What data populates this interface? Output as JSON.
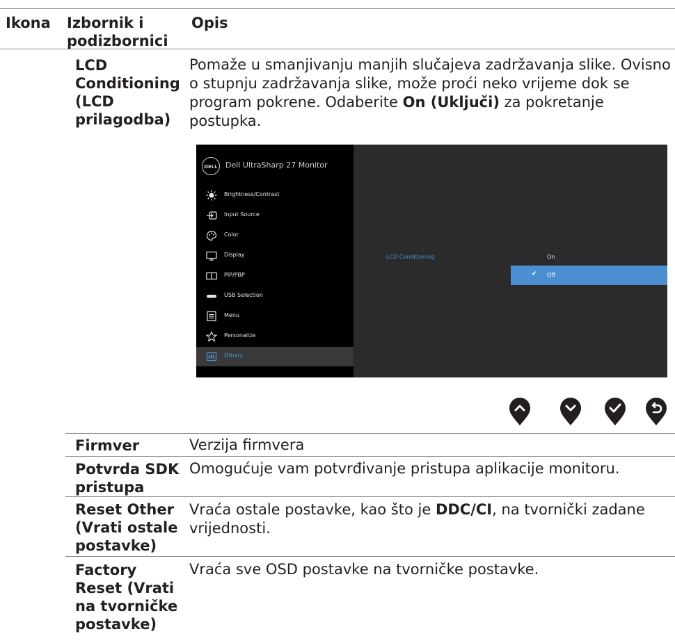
{
  "header": {
    "col_icon": "Ikona",
    "col_menu": "Izbornik i podizbornici",
    "col_desc": "Opis"
  },
  "lcd": {
    "menu": "LCD Conditioning (LCD prilagodba)",
    "desc_pre": "Pomaže u smanjivanju manjih slučajeva zadržavanja slike. Ovisno o stupnju zadržavanja slike, može proći neko vrijeme dok se program pokrene. Odaberite ",
    "desc_bold": "On (Uključi)",
    "desc_post": " za pokretanje postupka."
  },
  "osd": {
    "logo": "DELL",
    "title": "Dell UltraSharp 27 Monitor",
    "items": [
      {
        "label": "Brightness/Contrast",
        "icon": "brightness-icon"
      },
      {
        "label": "Input Source",
        "icon": "input-source-icon"
      },
      {
        "label": "Color",
        "icon": "color-palette-icon"
      },
      {
        "label": "Display",
        "icon": "display-icon"
      },
      {
        "label": "PIP/PBP",
        "icon": "pip-pbp-icon"
      },
      {
        "label": "USB Selection",
        "icon": "usb-icon"
      },
      {
        "label": "Menu",
        "icon": "menu-icon"
      },
      {
        "label": "Personalize",
        "icon": "star-icon"
      },
      {
        "label": "Others",
        "icon": "others-icon"
      }
    ],
    "option_label": "LCD Conditioning",
    "option_on": "On",
    "option_off": "Off",
    "selected": "Off",
    "accent": "#4b8fd2"
  },
  "nav_icons": [
    "up-arrow-icon",
    "down-arrow-icon",
    "check-icon",
    "back-icon"
  ],
  "rows": [
    {
      "menu": "Firmver",
      "desc": "Verzija firmvera"
    },
    {
      "menu": "Potvrda SDK pristupa",
      "desc": "Omogućuje vam potvrđivanje pristupa aplikacije monitoru."
    },
    {
      "menu": "Reset Other (Vrati ostale postavke)",
      "desc_pre": "Vraća ostale postavke, kao što je ",
      "desc_bold": "DDC/CI",
      "desc_post": ", na tvornički zadane vrijednosti."
    },
    {
      "menu": "Factory Reset (Vrati na tvorničke postavke)",
      "desc": "Vraća sve OSD postavke na tvorničke postavke."
    }
  ]
}
